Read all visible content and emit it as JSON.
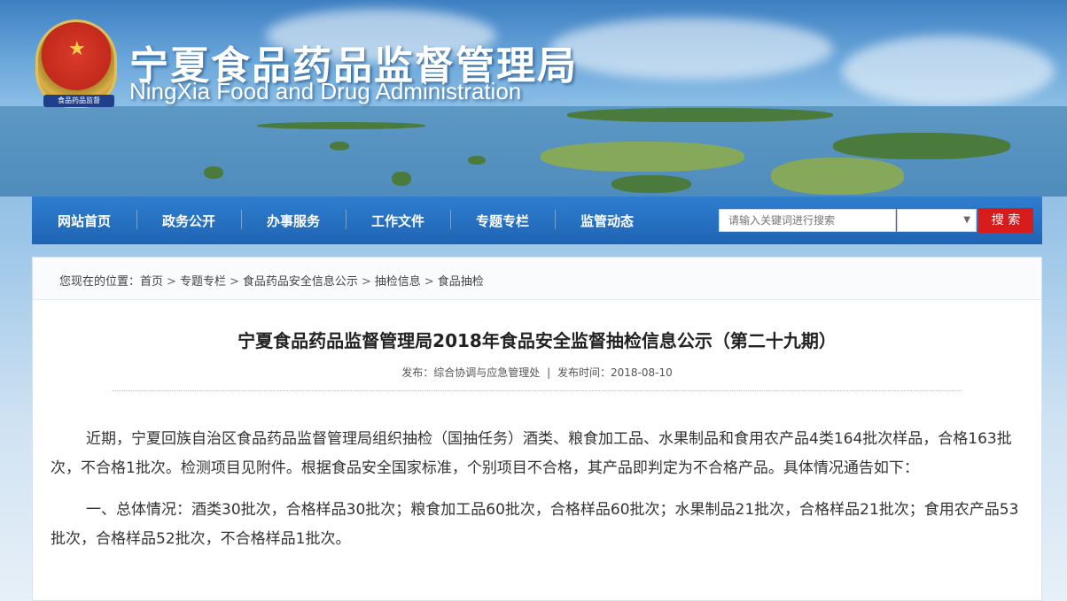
{
  "header": {
    "title_cn": "宁夏食品药品监督管理局",
    "title_en": "NingXia Food and Drug Administration",
    "emblem_ribbon": "食品药品监督"
  },
  "nav": {
    "items": [
      "网站首页",
      "政务公开",
      "办事服务",
      "工作文件",
      "专题专栏",
      "监管动态"
    ],
    "search_placeholder": "请输入关键词进行搜索",
    "search_button": "搜 索"
  },
  "breadcrumb": {
    "prefix": "您现在的位置：",
    "items": [
      "首页",
      "专题专栏",
      "食品药品安全信息公示",
      "抽检信息",
      "食品抽检"
    ]
  },
  "article": {
    "title": "宁夏食品药品监督管理局2018年食品安全监督抽检信息公示（第二十九期）",
    "publisher_label": "发布：综合协调与应急管理处",
    "time_label": "发布时间：2018-08-10",
    "paragraph1": "近期，宁夏回族自治区食品药品监督管理局组织抽检（国抽任务）酒类、粮食加工品、水果制品和食用农产品4类164批次样品，合格163批次，不合格1批次。检测项目见附件。根据食品安全国家标准，个别项目不合格，其产品即判定为不合格产品。具体情况通告如下：",
    "paragraph2": "一、总体情况：酒类30批次，合格样品30批次；粮食加工品60批次，合格样品60批次；水果制品21批次，合格样品21批次；食用农产品53批次，合格样品52批次，不合格样品1批次。"
  }
}
